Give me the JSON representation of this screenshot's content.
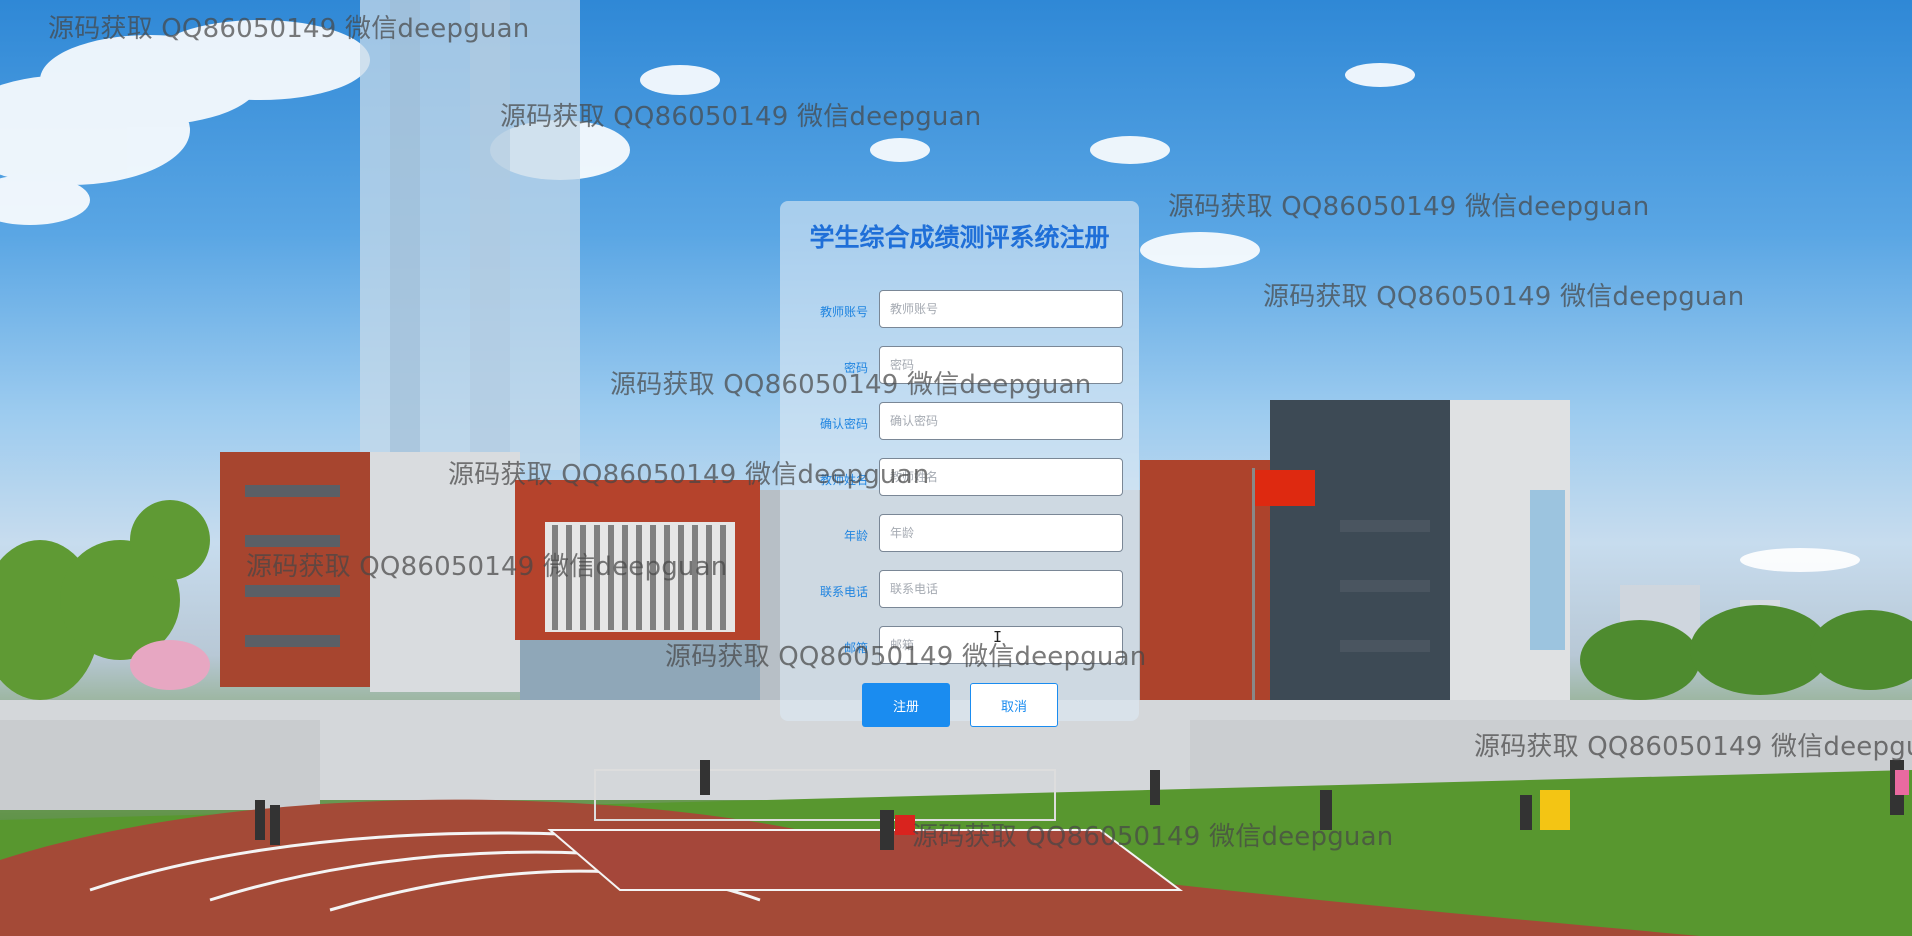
{
  "watermark_text": "源码获取 QQ86050149 微信deepguan",
  "form": {
    "title": "学生综合成绩测评系统注册",
    "fields": [
      {
        "label": "教师账号",
        "placeholder": "教师账号"
      },
      {
        "label": "密码",
        "placeholder": "密码"
      },
      {
        "label": "确认密码",
        "placeholder": "确认密码"
      },
      {
        "label": "教师姓名",
        "placeholder": "教师姓名"
      },
      {
        "label": "年龄",
        "placeholder": "年龄"
      },
      {
        "label": "联系电话",
        "placeholder": "联系电话"
      },
      {
        "label": "邮箱",
        "placeholder": "邮箱"
      }
    ],
    "submit_label": "注册",
    "cancel_label": "取消"
  },
  "colors": {
    "accent": "#1a8cf0",
    "title": "#1f6fd8",
    "label": "#1f84e0"
  }
}
